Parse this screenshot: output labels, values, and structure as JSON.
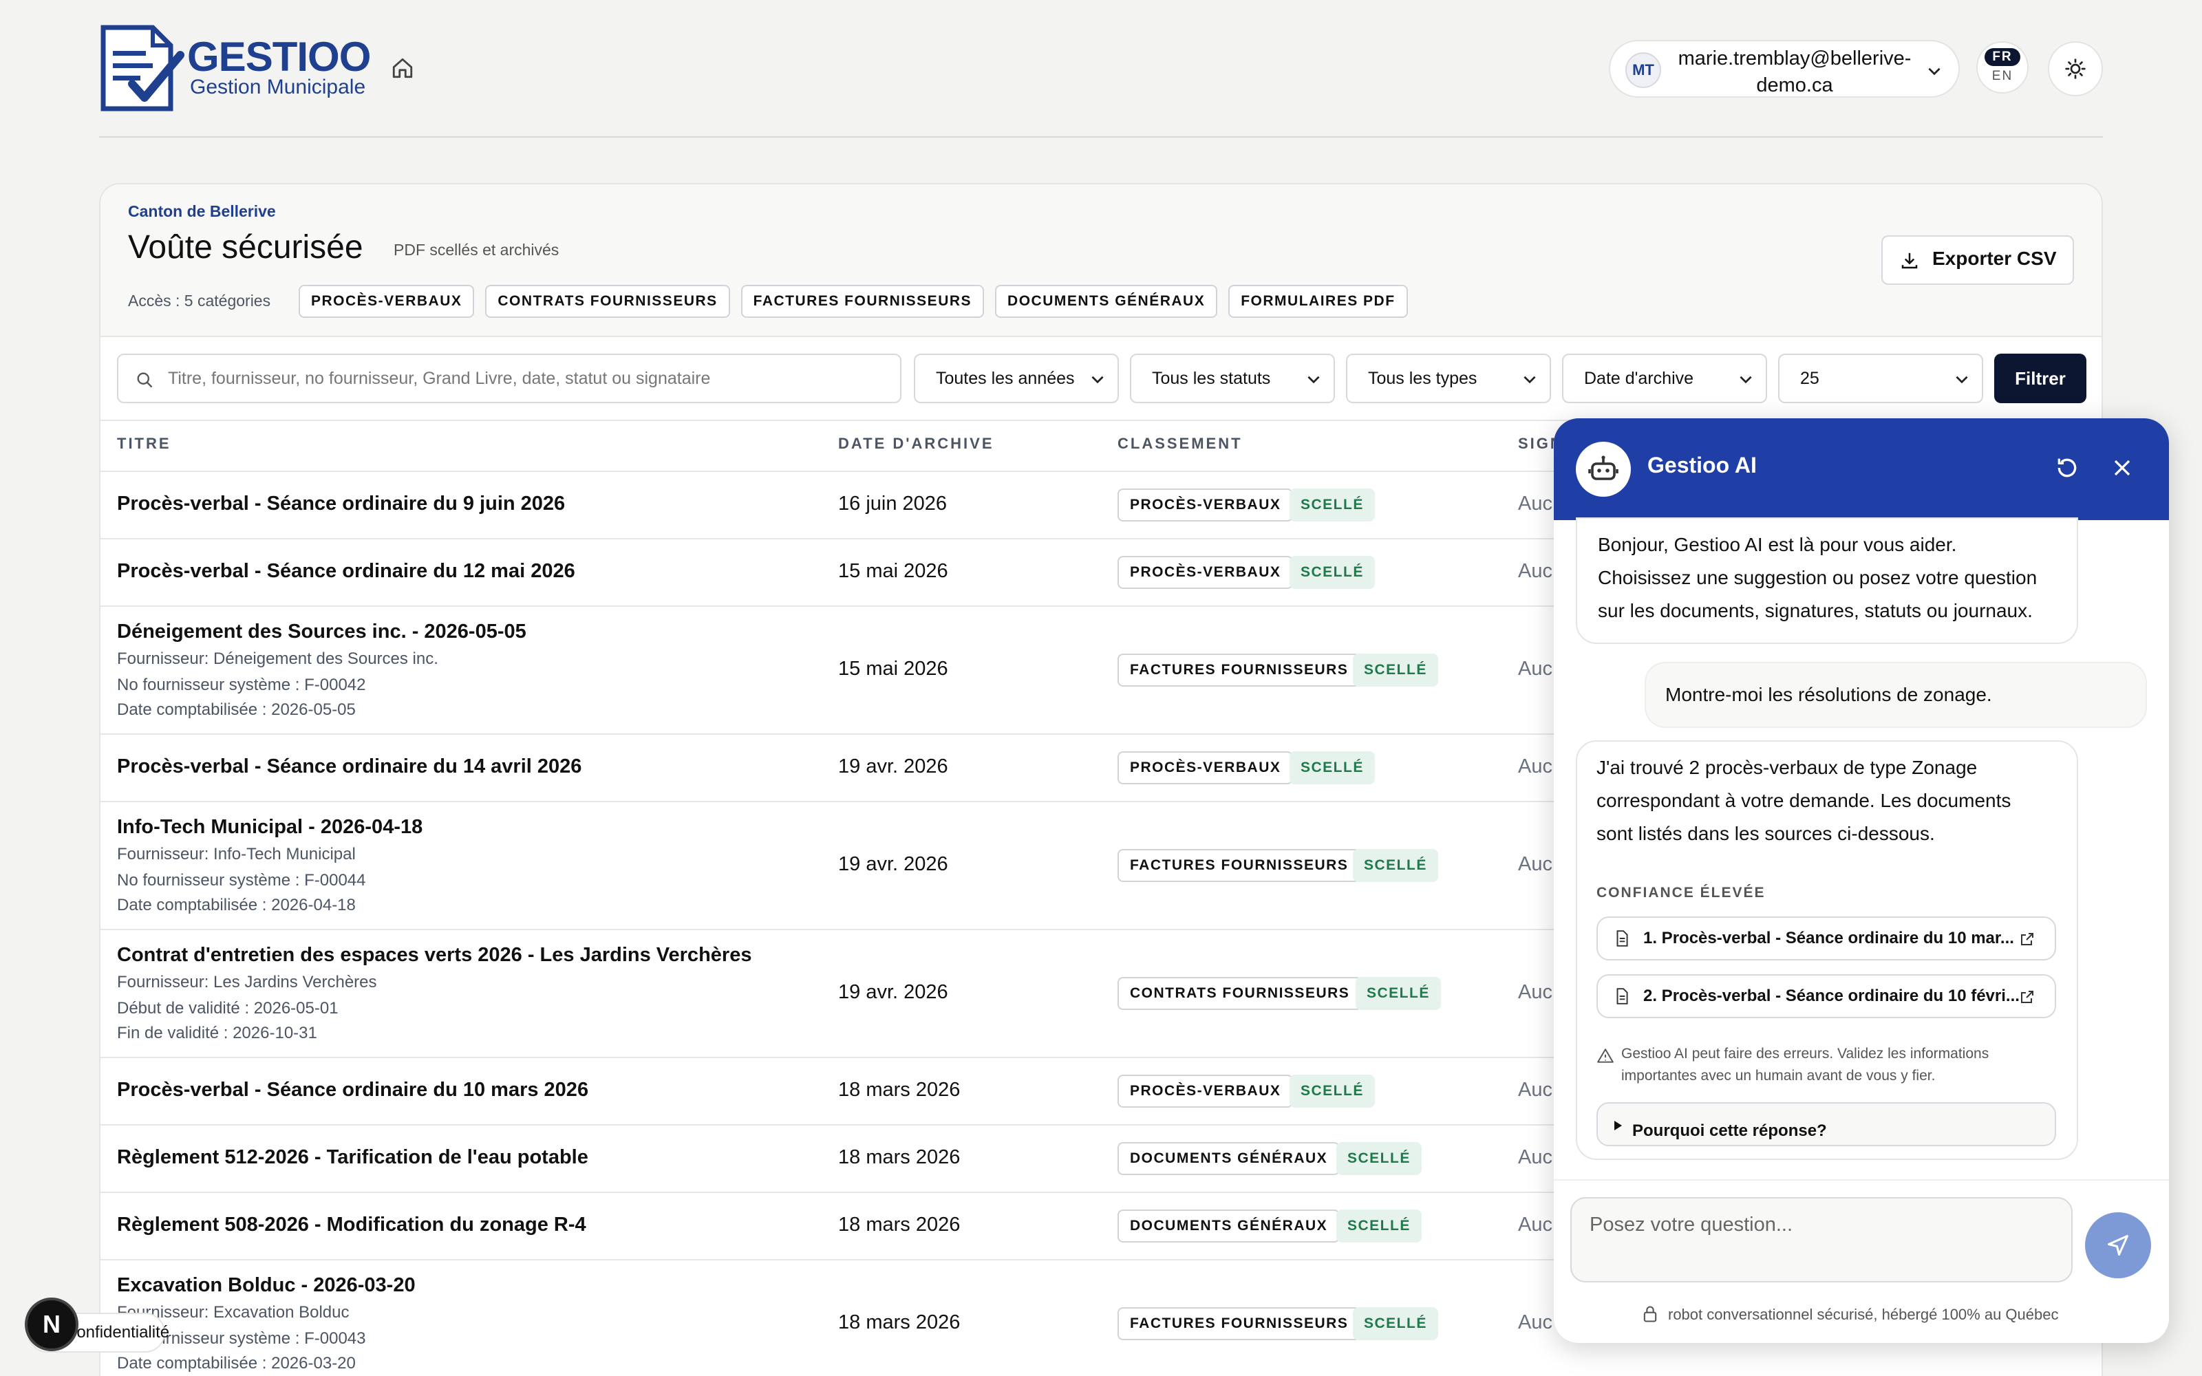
{
  "header": {
    "brand": "GESTIOO",
    "brand_sub": "Gestion Municipale",
    "user_initials": "MT",
    "user_email_line1": "marie.tremblay@bellerive-",
    "user_email_line2": "demo.ca",
    "lang_active": "FR",
    "lang_other": "EN"
  },
  "vault": {
    "org": "Canton de Bellerive",
    "title": "Voûte sécurisée",
    "subtitle": "PDF scellés et archivés",
    "access_label": "Accès : 5 catégories",
    "categories": [
      "PROCÈS-VERBAUX",
      "CONTRATS FOURNISSEURS",
      "FACTURES FOURNISSEURS",
      "DOCUMENTS GÉNÉRAUX",
      "FORMULAIRES PDF"
    ],
    "export_label": "Exporter CSV"
  },
  "filters": {
    "search_placeholder": "Titre, fournisseur, no fournisseur, Grand Livre, date, statut ou signataire",
    "year": "Toutes les années",
    "status": "Tous les statuts",
    "type": "Tous les types",
    "sort": "Date d'archive",
    "per_page": "25",
    "filter_button": "Filtrer"
  },
  "table": {
    "headers": [
      "TITRE",
      "DATE D'ARCHIVE",
      "CLASSEMENT",
      "SIGN"
    ],
    "rows": [
      {
        "title": "Procès-verbal - Séance ordinaire du 9 juin 2026",
        "date": "16 juin 2026",
        "class": "PROCÈS-VERBAUX",
        "status": "SCELLÉ",
        "sig": "Auc"
      },
      {
        "title": "Procès-verbal - Séance ordinaire du 12 mai 2026",
        "date": "15 mai 2026",
        "class": "PROCÈS-VERBAUX",
        "status": "SCELLÉ",
        "sig": "Auc"
      },
      {
        "title": "Déneigement des Sources inc. - 2026-05-05",
        "sub1": "Fournisseur: Déneigement des Sources inc.",
        "sub2": "No fournisseur système : F-00042",
        "sub3": "Date comptabilisée : 2026-05-05",
        "date": "15 mai 2026",
        "class": "FACTURES FOURNISSEURS",
        "status": "SCELLÉ",
        "sig": "Auc"
      },
      {
        "title": "Procès-verbal - Séance ordinaire du 14 avril 2026",
        "date": "19 avr. 2026",
        "class": "PROCÈS-VERBAUX",
        "status": "SCELLÉ",
        "sig": "Auc"
      },
      {
        "title": "Info-Tech Municipal - 2026-04-18",
        "sub1": "Fournisseur: Info-Tech Municipal",
        "sub2": "No fournisseur système : F-00044",
        "sub3": "Date comptabilisée : 2026-04-18",
        "date": "19 avr. 2026",
        "class": "FACTURES FOURNISSEURS",
        "status": "SCELLÉ",
        "sig": "Auc"
      },
      {
        "title": "Contrat d'entretien des espaces verts 2026 - Les Jardins Verchères",
        "sub1": "Fournisseur: Les Jardins Verchères",
        "sub2": "Début de validité : 2026-05-01",
        "sub3": "Fin de validité : 2026-10-31",
        "date": "19 avr. 2026",
        "class": "CONTRATS FOURNISSEURS",
        "status": "SCELLÉ",
        "sig": "Auc"
      },
      {
        "title": "Procès-verbal - Séance ordinaire du 10 mars 2026",
        "date": "18 mars 2026",
        "class": "PROCÈS-VERBAUX",
        "status": "SCELLÉ",
        "sig": "Auc"
      },
      {
        "title": "Règlement 512-2026 - Tarification de l'eau potable",
        "date": "18 mars 2026",
        "class": "DOCUMENTS GÉNÉRAUX",
        "status": "SCELLÉ",
        "sig": "Auc"
      },
      {
        "title": "Règlement 508-2026 - Modification du zonage R-4",
        "date": "18 mars 2026",
        "class": "DOCUMENTS GÉNÉRAUX",
        "status": "SCELLÉ",
        "sig": "Auc"
      },
      {
        "title": "Excavation Bolduc - 2026-03-20",
        "sub1": "Fournisseur: Excavation Bolduc",
        "sub2": "No fournisseur système : F-00043",
        "sub3": "Date comptabilisée : 2026-03-20",
        "date": "18 mars 2026",
        "class": "FACTURES FOURNISSEURS",
        "status": "SCELLÉ",
        "sig": "Auc"
      }
    ]
  },
  "chat": {
    "title": "Gestioo AI",
    "greeting_l1": "Bonjour, Gestioo AI est là pour vous aider.",
    "greeting_l2": "Choisissez une suggestion ou posez votre question",
    "greeting_l3": "sur les documents, signatures, statuts ou journaux.",
    "user_msg": "Montre-moi les résolutions de zonage.",
    "answer_l1": "J'ai trouvé 2 procès-verbaux de type Zonage",
    "answer_l2": "correspondant à votre demande. Les documents",
    "answer_l3": "sont listés dans les sources ci-dessous.",
    "confidence": "CONFIANCE ÉLEVÉE",
    "source1": "1. Procès-verbal - Séance ordinaire du 10 mar...",
    "source2": "2. Procès-verbal - Séance ordinaire du 10 févri...",
    "warning_l1": "Gestioo AI peut faire des erreurs. Validez les informations",
    "warning_l2": "importantes avec un humain avant de vous y fier.",
    "why": "Pourquoi cette réponse?",
    "input_placeholder": "Posez votre question...",
    "footer": "robot conversationnel sécurisé, hébergé 100% au Québec"
  },
  "overlay": {
    "badge_letter": "N",
    "privacy": "Confidentialité"
  }
}
